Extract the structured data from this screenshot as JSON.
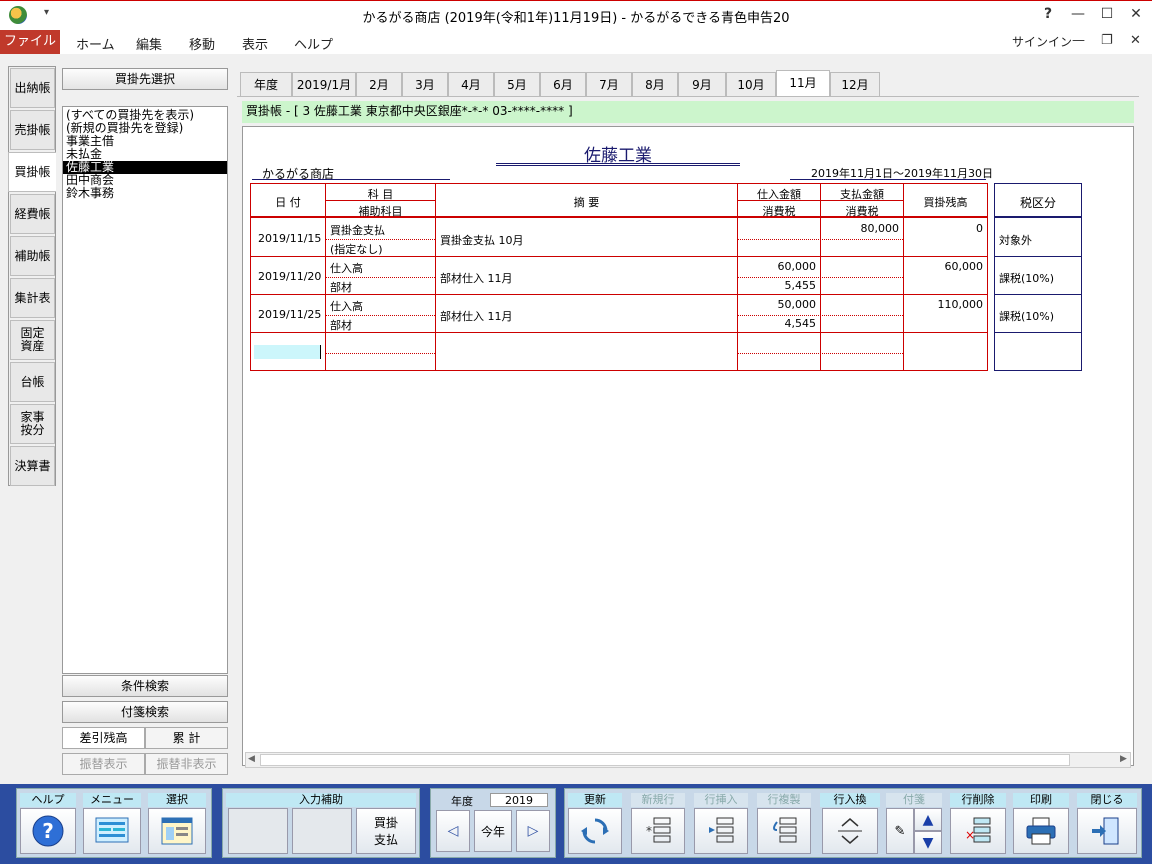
{
  "window": {
    "title": "かるがる商店 (2019年(令和1年)11月19日) - かるがるできる青色申告20",
    "controls": [
      "?",
      "—",
      "☐",
      "✕"
    ]
  },
  "menu": {
    "file": "ファイル",
    "items": [
      "ホーム",
      "編集",
      "移動",
      "表示",
      "ヘルプ"
    ],
    "signin": "サインイン"
  },
  "left_tabs": [
    {
      "label": "出納帳"
    },
    {
      "label": "売掛帳"
    },
    {
      "label": "買掛帳",
      "active": true
    },
    {
      "label": "経費帳"
    },
    {
      "label": "補助帳"
    },
    {
      "label": "集計表"
    },
    {
      "label": "固定\n資産"
    },
    {
      "label": "台帳"
    },
    {
      "label": "家事\n按分"
    },
    {
      "label": "決算書"
    }
  ],
  "vendor_panel": {
    "header": "買掛先選択",
    "items": [
      "(すべての買掛先を表示)",
      "(新規の買掛先を登録)",
      "事業主借",
      "未払金",
      "佐藤工業",
      "田中商会",
      "鈴木事務"
    ],
    "selected_index": 4,
    "condition_search": "条件検索",
    "tag_search": "付箋検索",
    "balance_btn": "差引残高",
    "cumulative_btn": "累 計",
    "transfer_show": "振替表示",
    "transfer_hide": "振替非表示"
  },
  "month_tabs": [
    "年度",
    "2019/1月",
    "2月",
    "3月",
    "4月",
    "5月",
    "6月",
    "7月",
    "8月",
    "9月",
    "10月",
    "11月",
    "12月"
  ],
  "active_month": "11月",
  "book_header": "買掛帳 - [ 3 佐藤工業 東京都中央区銀座*-*-* 03-****-**** ]",
  "ledger": {
    "vendor_name": "佐藤工業",
    "company": "かるがる商店",
    "period": "2019年11月1日～2019年11月30日",
    "headers": {
      "date": "日 付",
      "account": "科 目",
      "sub_account": "補助科目",
      "summary": "摘     要",
      "purchase": "仕入金額",
      "purchase_tax": "消費税",
      "payment": "支払金額",
      "payment_tax": "消費税",
      "balance": "買掛残高",
      "tax_class": "税区分"
    },
    "rows": [
      {
        "date": "2019/11/15",
        "account": "買掛金支払",
        "sub_account": "(指定なし)",
        "summary": "買掛金支払  10月",
        "purchase": "",
        "purchase_tax": "",
        "payment": "80,000",
        "payment_tax": "",
        "balance": "0",
        "tax_class": "対象外"
      },
      {
        "date": "2019/11/20",
        "account": "仕入高",
        "sub_account": "部材",
        "summary": "部材仕入  11月",
        "purchase": "60,000",
        "purchase_tax": "5,455",
        "payment": "",
        "payment_tax": "",
        "balance": "60,000",
        "tax_class": "課税(10%)"
      },
      {
        "date": "2019/11/25",
        "account": "仕入高",
        "sub_account": "部材",
        "summary": "部材仕入  11月",
        "purchase": "50,000",
        "purchase_tax": "4,545",
        "payment": "",
        "payment_tax": "",
        "balance": "110,000",
        "tax_class": "課税(10%)"
      }
    ]
  },
  "toolbar": {
    "help": "ヘルプ",
    "menu": "メニュー",
    "select": "選択",
    "input_assist": "入力補助",
    "input_assist_btn": "買掛\n支払",
    "fiscal_year_label": "年度",
    "fiscal_year": "2019",
    "this_year": "今年",
    "update": "更新",
    "new_row": "新規行",
    "insert_row": "行挿入",
    "copy_row": "行複製",
    "swap_row": "行入換",
    "sticky": "付箋",
    "delete_row": "行削除",
    "print": "印刷",
    "close": "閉じる"
  }
}
